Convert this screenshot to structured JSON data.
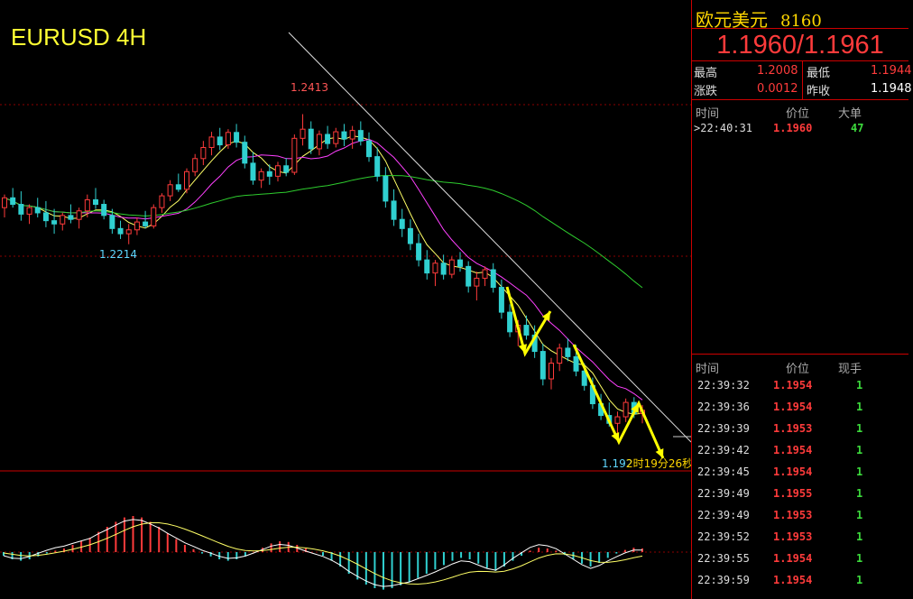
{
  "chart_data": {
    "type": "candlestick",
    "title": "EURUSD 4H",
    "price_range": [
      1.187,
      1.256
    ],
    "annotations": {
      "high_label": "1.2413",
      "low_label_left": "1.2214",
      "low_label_right": "1.192",
      "countdown": "2时19分26秒"
    },
    "candles": [
      [
        1.227,
        1.229,
        1.2255,
        1.2285
      ],
      [
        1.2285,
        1.23,
        1.227,
        1.2275
      ],
      [
        1.2275,
        1.2295,
        1.225,
        1.226
      ],
      [
        1.226,
        1.2275,
        1.2245,
        1.227
      ],
      [
        1.227,
        1.2285,
        1.2255,
        1.2262
      ],
      [
        1.2262,
        1.228,
        1.224,
        1.225
      ],
      [
        1.225,
        1.2268,
        1.223,
        1.2245
      ],
      [
        1.2245,
        1.2262,
        1.2235,
        1.2258
      ],
      [
        1.2258,
        1.2275,
        1.2246,
        1.2252
      ],
      [
        1.2252,
        1.227,
        1.2238,
        1.2265
      ],
      [
        1.2265,
        1.229,
        1.2255,
        1.2282
      ],
      [
        1.2282,
        1.23,
        1.2268,
        1.2275
      ],
      [
        1.2275,
        1.2282,
        1.2252,
        1.2258
      ],
      [
        1.2258,
        1.2268,
        1.223,
        1.2238
      ],
      [
        1.2238,
        1.225,
        1.2222,
        1.223
      ],
      [
        1.223,
        1.2245,
        1.2214,
        1.2236
      ],
      [
        1.2236,
        1.2255,
        1.2228,
        1.2248
      ],
      [
        1.2248,
        1.2265,
        1.2238,
        1.2242
      ],
      [
        1.2242,
        1.2275,
        1.2238,
        1.227
      ],
      [
        1.227,
        1.2292,
        1.2262,
        1.2288
      ],
      [
        1.2288,
        1.2312,
        1.228,
        1.2305
      ],
      [
        1.2305,
        1.2322,
        1.2294,
        1.2298
      ],
      [
        1.2298,
        1.233,
        1.2292,
        1.2325
      ],
      [
        1.2325,
        1.2352,
        1.2318,
        1.2345
      ],
      [
        1.2345,
        1.2372,
        1.2335,
        1.2362
      ],
      [
        1.2362,
        1.2386,
        1.235,
        1.2378
      ],
      [
        1.2378,
        1.2392,
        1.2358,
        1.2366
      ],
      [
        1.2366,
        1.239,
        1.236,
        1.2385
      ],
      [
        1.2385,
        1.2398,
        1.2362,
        1.237
      ],
      [
        1.237,
        1.238,
        1.233,
        1.2338
      ],
      [
        1.2338,
        1.2355,
        1.2305,
        1.2312
      ],
      [
        1.2312,
        1.233,
        1.23,
        1.2325
      ],
      [
        1.2325,
        1.2336,
        1.2305,
        1.2318
      ],
      [
        1.2318,
        1.234,
        1.231,
        1.2334
      ],
      [
        1.2334,
        1.2346,
        1.2318,
        1.2324
      ],
      [
        1.2324,
        1.2382,
        1.232,
        1.2376
      ],
      [
        1.2376,
        1.2413,
        1.2365,
        1.239
      ],
      [
        1.239,
        1.2402,
        1.2352,
        1.236
      ],
      [
        1.236,
        1.2388,
        1.235,
        1.2382
      ],
      [
        1.2382,
        1.2395,
        1.236,
        1.2368
      ],
      [
        1.2368,
        1.2392,
        1.2362,
        1.2386
      ],
      [
        1.2386,
        1.2398,
        1.2364,
        1.2375
      ],
      [
        1.2375,
        1.2395,
        1.236,
        1.2388
      ],
      [
        1.2388,
        1.2402,
        1.2365,
        1.2372
      ],
      [
        1.2372,
        1.2385,
        1.234,
        1.2348
      ],
      [
        1.2348,
        1.2362,
        1.231,
        1.2318
      ],
      [
        1.2318,
        1.2332,
        1.227,
        1.228
      ],
      [
        1.228,
        1.2298,
        1.2242,
        1.2252
      ],
      [
        1.2252,
        1.2268,
        1.2225,
        1.2238
      ],
      [
        1.2238,
        1.2252,
        1.2205,
        1.2215
      ],
      [
        1.2215,
        1.223,
        1.218,
        1.219
      ],
      [
        1.219,
        1.2205,
        1.216,
        1.217
      ],
      [
        1.217,
        1.219,
        1.215,
        1.2185
      ],
      [
        1.2185,
        1.2198,
        1.216,
        1.2168
      ],
      [
        1.2168,
        1.2195,
        1.2162,
        1.219
      ],
      [
        1.219,
        1.2202,
        1.2172,
        1.218
      ],
      [
        1.218,
        1.2188,
        1.214,
        1.215
      ],
      [
        1.215,
        1.2172,
        1.2128,
        1.2162
      ],
      [
        1.2162,
        1.218,
        1.215,
        1.2175
      ],
      [
        1.2175,
        1.2185,
        1.214,
        1.2148
      ],
      [
        1.2148,
        1.216,
        1.21,
        1.211
      ],
      [
        1.211,
        1.2122,
        1.2072,
        1.208
      ],
      [
        1.208,
        1.2098,
        1.2058,
        1.209
      ],
      [
        1.209,
        1.2105,
        1.2068,
        1.2075
      ],
      [
        1.2075,
        1.209,
        1.204,
        1.205
      ],
      [
        1.205,
        1.2062,
        1.1998,
        1.2008
      ],
      [
        1.2008,
        1.204,
        1.1992,
        1.2032
      ],
      [
        1.2032,
        1.2062,
        1.202,
        1.2055
      ],
      [
        1.2055,
        1.207,
        1.2035,
        1.2042
      ],
      [
        1.2042,
        1.206,
        1.2012,
        1.202
      ],
      [
        1.202,
        1.2032,
        1.199,
        1.1998
      ],
      [
        1.1998,
        1.201,
        1.1962,
        1.197
      ],
      [
        1.197,
        1.1985,
        1.1945,
        1.1952
      ],
      [
        1.1952,
        1.1972,
        1.1935,
        1.194
      ],
      [
        1.194,
        1.1958,
        1.1922,
        1.195
      ],
      [
        1.195,
        1.1978,
        1.1942,
        1.1972
      ],
      [
        1.1972,
        1.198,
        1.1948,
        1.1955
      ],
      [
        1.1955,
        1.1968,
        1.194,
        1.196
      ]
    ],
    "moving_averages": [
      {
        "color": "#ffff66",
        "period": 5
      },
      {
        "color": "#ff40ff",
        "period": 10
      },
      {
        "color": "#2ecc2e",
        "period": 40
      }
    ],
    "trendline": {
      "color": "#dddddd"
    },
    "macd_histogram": [
      -0.05,
      -0.1,
      -0.12,
      -0.1,
      -0.06,
      -0.02,
      0.02,
      0.05,
      0.1,
      0.15,
      0.2,
      0.28,
      0.35,
      0.42,
      0.48,
      0.5,
      0.48,
      0.42,
      0.35,
      0.26,
      0.18,
      0.1,
      0.04,
      -0.02,
      -0.06,
      -0.1,
      -0.12,
      -0.1,
      -0.06,
      0.0,
      0.06,
      0.12,
      0.15,
      0.14,
      0.1,
      0.05,
      0.0,
      -0.05,
      -0.12,
      -0.2,
      -0.3,
      -0.38,
      -0.45,
      -0.5,
      -0.52,
      -0.5,
      -0.46,
      -0.42,
      -0.36,
      -0.3,
      -0.24,
      -0.18,
      -0.12,
      -0.08,
      -0.1,
      -0.16,
      -0.22,
      -0.26,
      -0.2,
      -0.12,
      -0.05,
      0.02,
      0.06,
      0.05,
      0.02,
      -0.04,
      -0.1,
      -0.16,
      -0.2,
      -0.15,
      -0.08,
      -0.02,
      0.03,
      0.06,
      0.05
    ]
  },
  "panel": {
    "name": "欧元美元",
    "code": "8160",
    "quote": "1.1960/1.1961",
    "stats": [
      {
        "label": "最高",
        "value": "1.2008",
        "color": "red"
      },
      {
        "label": "最低",
        "value": "1.1944",
        "color": "red"
      },
      {
        "label": "涨跌",
        "value": "0.0012",
        "color": "red"
      },
      {
        "label": "昨收",
        "value": "1.1948",
        "color": "wht"
      }
    ],
    "big_trades_headers": [
      "时间",
      "价位",
      "大单"
    ],
    "big_trades": [
      {
        "time": ">22:40:31",
        "price": "1.1960",
        "vol": "47"
      }
    ],
    "ticks_headers": [
      "时间",
      "价位",
      "现手"
    ],
    "ticks": [
      {
        "time": "22:39:32",
        "price": "1.1954",
        "vol": "1"
      },
      {
        "time": "22:39:36",
        "price": "1.1954",
        "vol": "1"
      },
      {
        "time": "22:39:39",
        "price": "1.1953",
        "vol": "1"
      },
      {
        "time": "22:39:42",
        "price": "1.1954",
        "vol": "1"
      },
      {
        "time": "22:39:45",
        "price": "1.1954",
        "vol": "1"
      },
      {
        "time": "22:39:49",
        "price": "1.1955",
        "vol": "1"
      },
      {
        "time": "22:39:49",
        "price": "1.1953",
        "vol": "1"
      },
      {
        "time": "22:39:52",
        "price": "1.1953",
        "vol": "1"
      },
      {
        "time": "22:39:55",
        "price": "1.1954",
        "vol": "1"
      },
      {
        "time": "22:39:59",
        "price": "1.1954",
        "vol": "1"
      }
    ]
  }
}
